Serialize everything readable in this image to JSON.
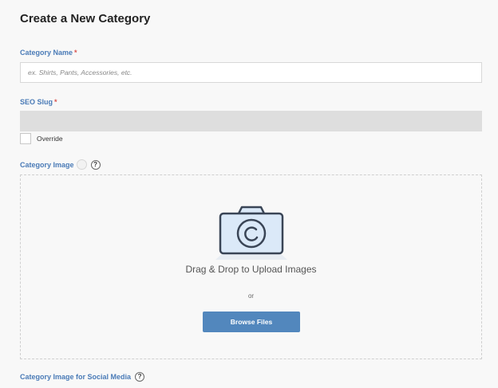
{
  "form": {
    "title": "Create a New Category",
    "required_marker": "*",
    "category_name": {
      "label": "Category Name",
      "value": "",
      "placeholder": "ex. Shirts, Pants, Accessories, etc."
    },
    "seo_slug": {
      "label": "SEO Slug",
      "value": ""
    },
    "override": {
      "label": "Override",
      "checked": false
    },
    "category_image": {
      "label": "Category Image",
      "help_glyph": "?",
      "dropzone_text": "Drag & Drop to Upload Images",
      "or_text": "or",
      "browse_label": "Browse Files"
    },
    "social_image": {
      "label": "Category Image for Social Media",
      "help_glyph": "?"
    }
  },
  "colors": {
    "label_blue": "#4a7bb7",
    "required_red": "#d9534f",
    "button_blue": "#5287bd",
    "camera_stroke": "#3a4556",
    "camera_fill": "#dbe9f8"
  },
  "icons": {
    "camera": "camera-icon",
    "help": "help-icon"
  }
}
